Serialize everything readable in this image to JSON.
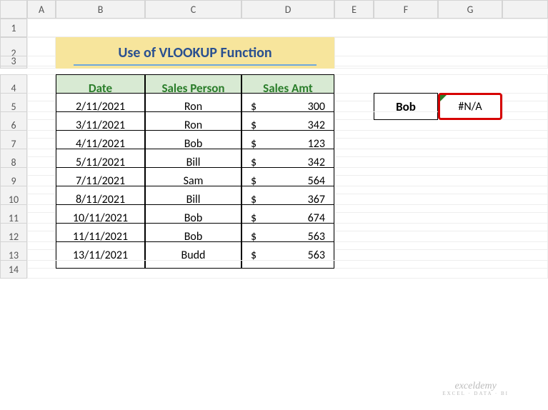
{
  "columns": [
    "",
    "A",
    "B",
    "C",
    "D",
    "E",
    "F",
    "G",
    ""
  ],
  "rows": [
    "1",
    "2",
    "3",
    "4",
    "5",
    "6",
    "7",
    "8",
    "9",
    "10",
    "11",
    "12",
    "13",
    "14"
  ],
  "title": "Use of VLOOKUP Function",
  "headers": {
    "date": "Date",
    "person": "Sales Person",
    "amt": "Sales Amt"
  },
  "currency": "$",
  "data": [
    {
      "date": "2/11/2021",
      "person": "Ron",
      "amt": "300"
    },
    {
      "date": "3/11/2021",
      "person": "Ron",
      "amt": "342"
    },
    {
      "date": "4/11/2021",
      "person": "Bob",
      "amt": "123"
    },
    {
      "date": "5/11/2021",
      "person": "Bill",
      "amt": "342"
    },
    {
      "date": "7/11/2021",
      "person": "Sam",
      "amt": "564"
    },
    {
      "date": "8/11/2021",
      "person": "Bill",
      "amt": "367"
    },
    {
      "date": "10/11/2021",
      "person": "Bob",
      "amt": "674"
    },
    {
      "date": "11/11/2021",
      "person": "Bob",
      "amt": "563"
    },
    {
      "date": "13/11/2021",
      "person": "Budd",
      "amt": "563"
    }
  ],
  "lookup": {
    "name": "Bob",
    "result": "#N/A"
  },
  "watermark": {
    "main": "exceldemy",
    "sub": "EXCEL · DATA · BI"
  }
}
